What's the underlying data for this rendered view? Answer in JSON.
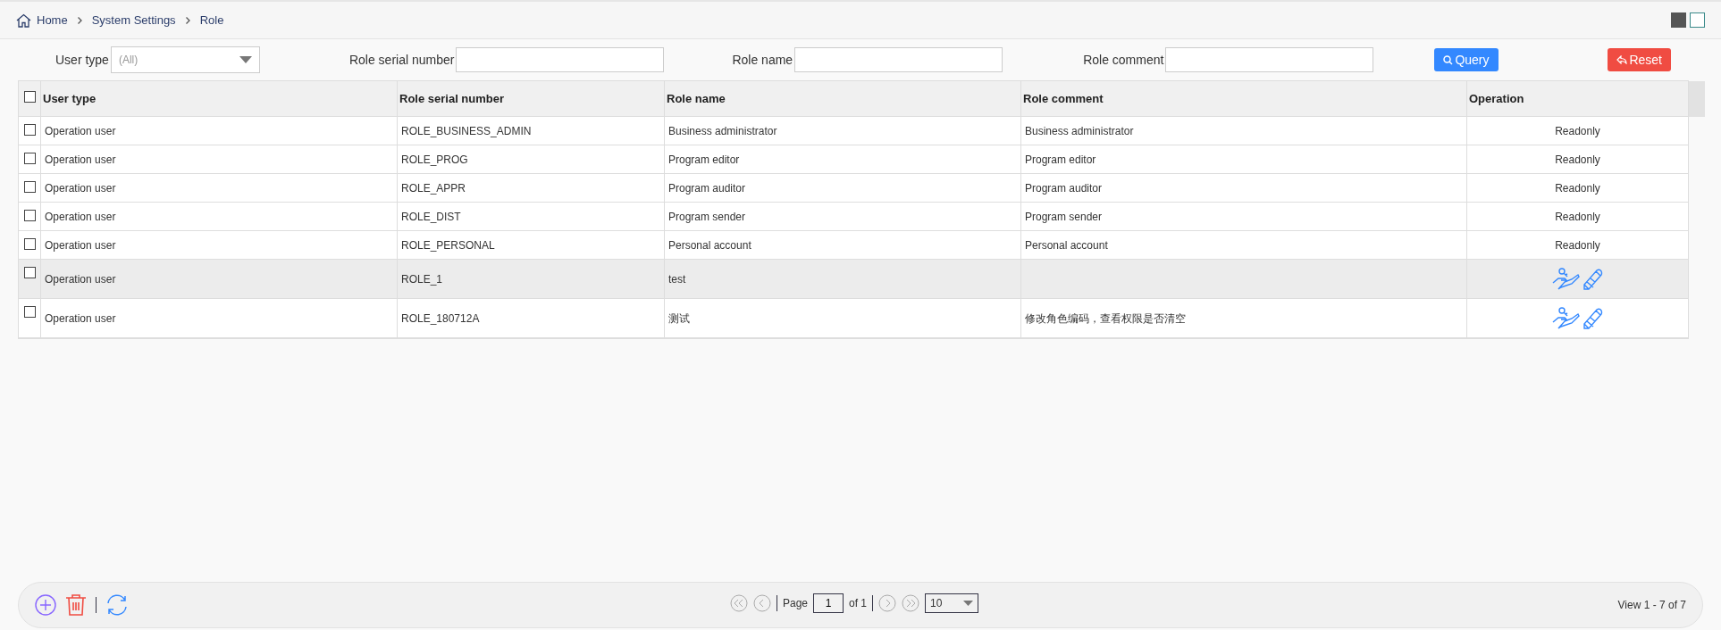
{
  "breadcrumb": [
    "Home",
    "System Settings",
    "Role"
  ],
  "filters": {
    "user_type": {
      "label": "User type",
      "value": "(All)"
    },
    "serial": {
      "label": "Role serial number"
    },
    "name": {
      "label": "Role name"
    },
    "comment": {
      "label": "Role comment"
    },
    "query": "Query",
    "reset": "Reset"
  },
  "table": {
    "select_all": {
      "checked": false
    },
    "columns": [
      "User type",
      "Role serial number",
      "Role name",
      "Role comment",
      "Operation"
    ],
    "rows": [
      {
        "checked": false,
        "highlighted": false,
        "cells": [
          "Operation user",
          "ROLE_BUSINESS_ADMIN",
          "Business administrator",
          "Business administrator"
        ],
        "operation": {
          "kind": "text",
          "text": "Readonly"
        }
      },
      {
        "checked": false,
        "highlighted": false,
        "cells": [
          "Operation user",
          "ROLE_PROG",
          "Program editor",
          "Program editor"
        ],
        "operation": {
          "kind": "text",
          "text": "Readonly"
        }
      },
      {
        "checked": false,
        "highlighted": false,
        "cells": [
          "Operation user",
          "ROLE_APPR",
          "Program auditor",
          "Program auditor"
        ],
        "operation": {
          "kind": "text",
          "text": "Readonly"
        }
      },
      {
        "checked": false,
        "highlighted": false,
        "cells": [
          "Operation user",
          "ROLE_DIST",
          "Program sender",
          "Program sender"
        ],
        "operation": {
          "kind": "text",
          "text": "Readonly"
        }
      },
      {
        "checked": false,
        "highlighted": false,
        "cells": [
          "Operation user",
          "ROLE_PERSONAL",
          "Personal account",
          "Personal account"
        ],
        "operation": {
          "kind": "text",
          "text": "Readonly"
        }
      },
      {
        "checked": false,
        "highlighted": true,
        "cells": [
          "Operation user",
          "ROLE_1",
          "test",
          ""
        ],
        "operation": {
          "kind": "actions"
        }
      },
      {
        "checked": false,
        "highlighted": false,
        "cells": [
          "Operation user",
          "ROLE_180712A",
          "测试",
          "修改角色编码，查看权限是否清空"
        ],
        "operation": {
          "kind": "actions"
        }
      }
    ]
  },
  "pager": {
    "page_label": "Page",
    "page": "1",
    "of": "of 1",
    "page_size": "10",
    "summary": "View 1 - 7 of 7"
  }
}
